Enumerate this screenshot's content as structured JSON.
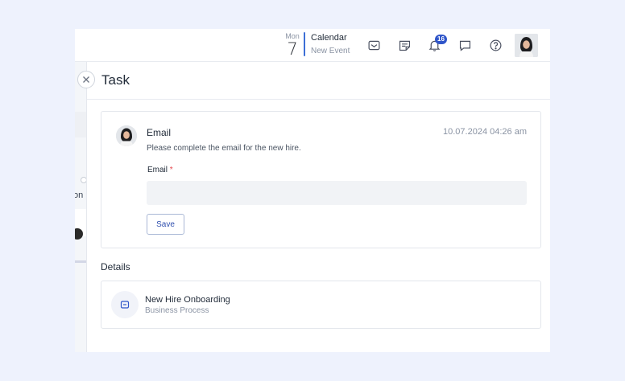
{
  "header": {
    "date": {
      "weekday": "Mon",
      "day": "7"
    },
    "calendar": {
      "title": "Calendar",
      "subtitle": "New Event"
    },
    "icons": [
      "inbox-icon",
      "notes-icon",
      "bell-icon",
      "chat-icon",
      "help-icon"
    ],
    "notification_count": "16",
    "accent_color": "#3d6fd6"
  },
  "background_panel": {
    "truncated_text": "on p"
  },
  "drawer": {
    "title": "Task",
    "task_card": {
      "title": "Email",
      "timestamp": "10.07.2024 04:26 am",
      "description": "Please complete the email for the new hire.",
      "field": {
        "label": "Email",
        "required_marker": "*",
        "value": "",
        "placeholder": ""
      },
      "save_label": "Save"
    },
    "details": {
      "heading": "Details",
      "process": {
        "title": "New Hire Onboarding",
        "subtitle": "Business Process",
        "icon": "workflow-icon"
      }
    }
  },
  "colors": {
    "page_background": "#eef2fd",
    "badge": "#2f55c9",
    "button_text": "#2f4fae",
    "required": "#e5484d"
  }
}
